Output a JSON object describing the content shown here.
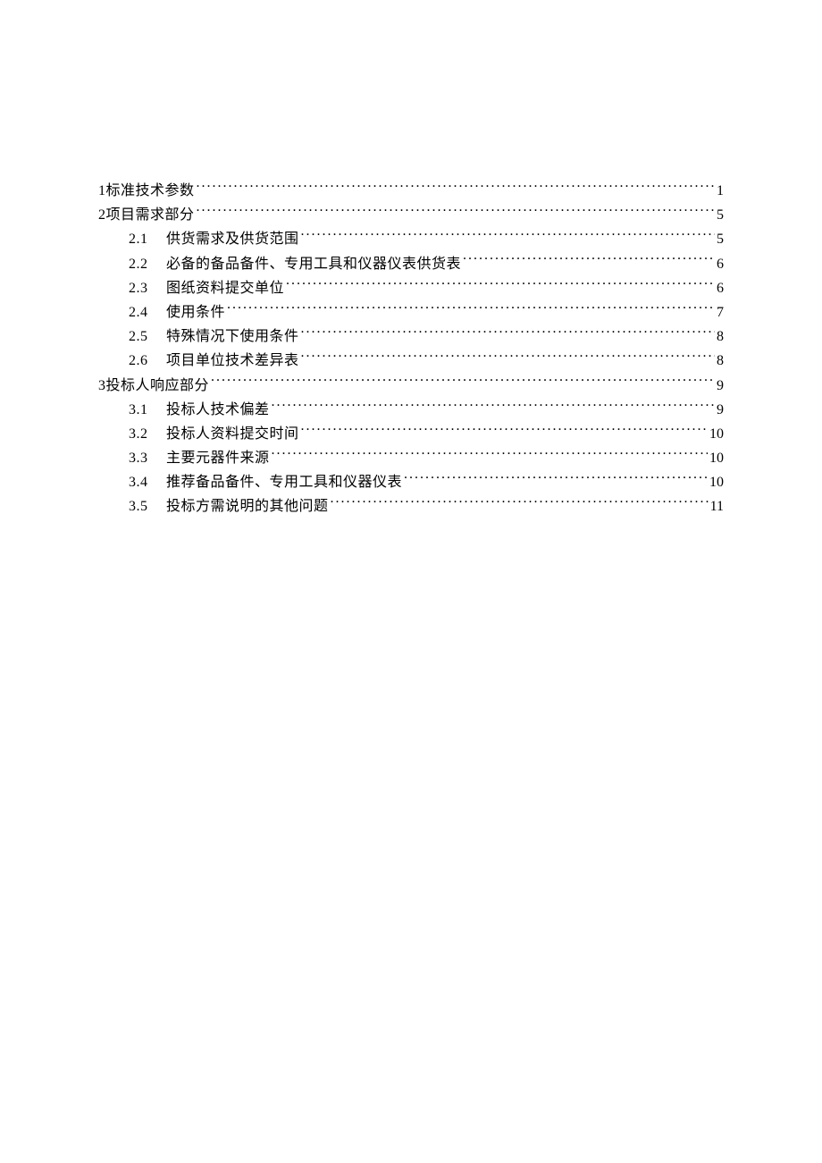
{
  "toc": [
    {
      "num": "1",
      "title": "标准技术参数",
      "page": "1",
      "level": 0
    },
    {
      "num": "2",
      "title": "项目需求部分",
      "page": "5",
      "level": 0
    },
    {
      "num": "2.1",
      "title": "供货需求及供货范围",
      "page": "5",
      "level": 1
    },
    {
      "num": "2.2",
      "title": "必备的备品备件、专用工具和仪器仪表供货表",
      "page": "6",
      "level": 1
    },
    {
      "num": "2.3",
      "title": "图纸资料提交单位",
      "page": "6",
      "level": 1
    },
    {
      "num": "2.4",
      "title": "使用条件",
      "page": "7",
      "level": 1
    },
    {
      "num": "2.5",
      "title": "特殊情况下使用条件",
      "page": "8",
      "level": 1
    },
    {
      "num": "2.6",
      "title": "项目单位技术差异表",
      "page": "8",
      "level": 1
    },
    {
      "num": "3",
      "title": "投标人响应部分",
      "page": "9",
      "level": 0
    },
    {
      "num": "3.1",
      "title": "投标人技术偏差",
      "page": "9",
      "level": 1
    },
    {
      "num": "3.2",
      "title": "投标人资料提交时间",
      "page": "10",
      "level": 1
    },
    {
      "num": "3.3",
      "title": "主要元器件来源",
      "page": "10",
      "level": 1
    },
    {
      "num": "3.4",
      "title": "推荐备品备件、专用工具和仪器仪表",
      "page": "10",
      "level": 1
    },
    {
      "num": "3.5",
      "title": "投标方需说明的其他问题",
      "page": "11",
      "level": 1
    }
  ]
}
